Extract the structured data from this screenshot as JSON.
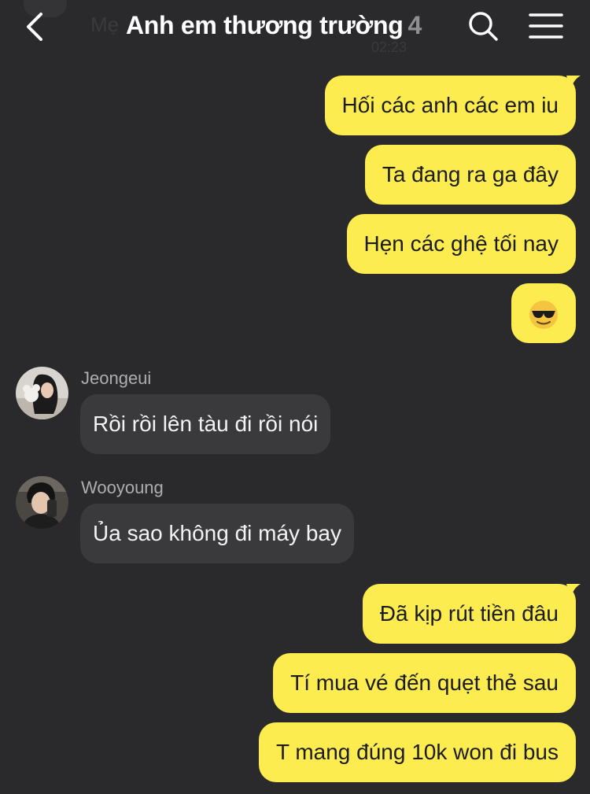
{
  "header": {
    "ghost_name": "Mẹ",
    "ghost_time": "02:23",
    "title": "Anh em thương trường",
    "member_count": "4",
    "back_icon": "chevron-left-icon",
    "search_icon": "search-icon",
    "menu_icon": "hamburger-menu-icon"
  },
  "colors": {
    "background": "#2a2a2c",
    "outgoing_bubble": "#fcec4f",
    "incoming_bubble": "#3a3a3c",
    "muted_text": "#8e8e93"
  },
  "messages": {
    "out_1": "Hối các anh các em iu",
    "out_2": "Ta đang ra ga đây",
    "out_3": "Hẹn các ghệ tối nay",
    "out_4": "😎",
    "in_1_sender": "Jeongeui",
    "in_1_text": "Rồi rồi lên tàu đi rồi nói",
    "in_2_sender": "Wooyoung",
    "in_2_text": "Ủa sao không đi máy bay",
    "out_5": "Đã kịp rút tiền đâu",
    "out_6": "Tí mua vé đến quẹt thẻ sau",
    "out_7": "T mang đúng 10k won đi bus"
  }
}
